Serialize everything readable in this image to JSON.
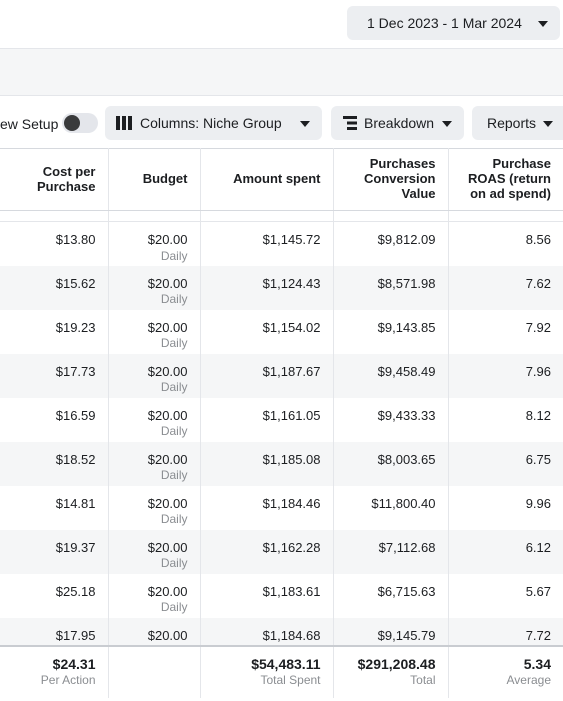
{
  "date_range": {
    "label": "1 Dec 2023 - 1 Mar 2024"
  },
  "toolbar": {
    "view_setup_label": "ew Setup",
    "columns_label": "Columns: Niche Group",
    "breakdown_label": "Breakdown",
    "reports_label": "Reports"
  },
  "table": {
    "headers": {
      "cost_per_purchase": [
        "Cost per",
        "Purchase"
      ],
      "budget": "Budget",
      "amount_spent": "Amount spent",
      "purchases_value": [
        "Purchases",
        "Conversion",
        "Value"
      ],
      "roas": [
        "Purchase",
        "ROAS (return",
        "on ad spend)"
      ]
    },
    "budget_sub": "Daily",
    "rows": [
      {
        "cpp": "$13.80",
        "budget": "$20.00",
        "spent": "$1,145.72",
        "value": "$9,812.09",
        "roas": "8.56"
      },
      {
        "cpp": "$15.62",
        "budget": "$20.00",
        "spent": "$1,124.43",
        "value": "$8,571.98",
        "roas": "7.62"
      },
      {
        "cpp": "$19.23",
        "budget": "$20.00",
        "spent": "$1,154.02",
        "value": "$9,143.85",
        "roas": "7.92"
      },
      {
        "cpp": "$17.73",
        "budget": "$20.00",
        "spent": "$1,187.67",
        "value": "$9,458.49",
        "roas": "7.96"
      },
      {
        "cpp": "$16.59",
        "budget": "$20.00",
        "spent": "$1,161.05",
        "value": "$9,433.33",
        "roas": "8.12"
      },
      {
        "cpp": "$18.52",
        "budget": "$20.00",
        "spent": "$1,185.08",
        "value": "$8,003.65",
        "roas": "6.75"
      },
      {
        "cpp": "$14.81",
        "budget": "$20.00",
        "spent": "$1,184.46",
        "value": "$11,800.40",
        "roas": "9.96"
      },
      {
        "cpp": "$19.37",
        "budget": "$20.00",
        "spent": "$1,162.28",
        "value": "$7,112.68",
        "roas": "6.12"
      },
      {
        "cpp": "$25.18",
        "budget": "$20.00",
        "spent": "$1,183.61",
        "value": "$6,715.63",
        "roas": "5.67"
      },
      {
        "cpp": "$17.95",
        "budget": "$20.00",
        "spent": "$1,184.68",
        "value": "$9,145.79",
        "roas": "7.72"
      }
    ],
    "totals": {
      "cpp": "$24.31",
      "cpp_sub": "Per Action",
      "spent": "$54,483.11",
      "spent_sub": "Total Spent",
      "value": "$291,208.48",
      "value_sub": "Total",
      "roas": "5.34",
      "roas_sub": "Average"
    }
  },
  "colors": {
    "button_bg": "#eceef1",
    "row_alt": "#f5f6f7",
    "text": "#1c1e21",
    "muted": "#8a8d91"
  },
  "icons": {
    "columns": "columns-icon",
    "breakdown": "breakdown-icon",
    "caret": "caret-down-icon"
  }
}
